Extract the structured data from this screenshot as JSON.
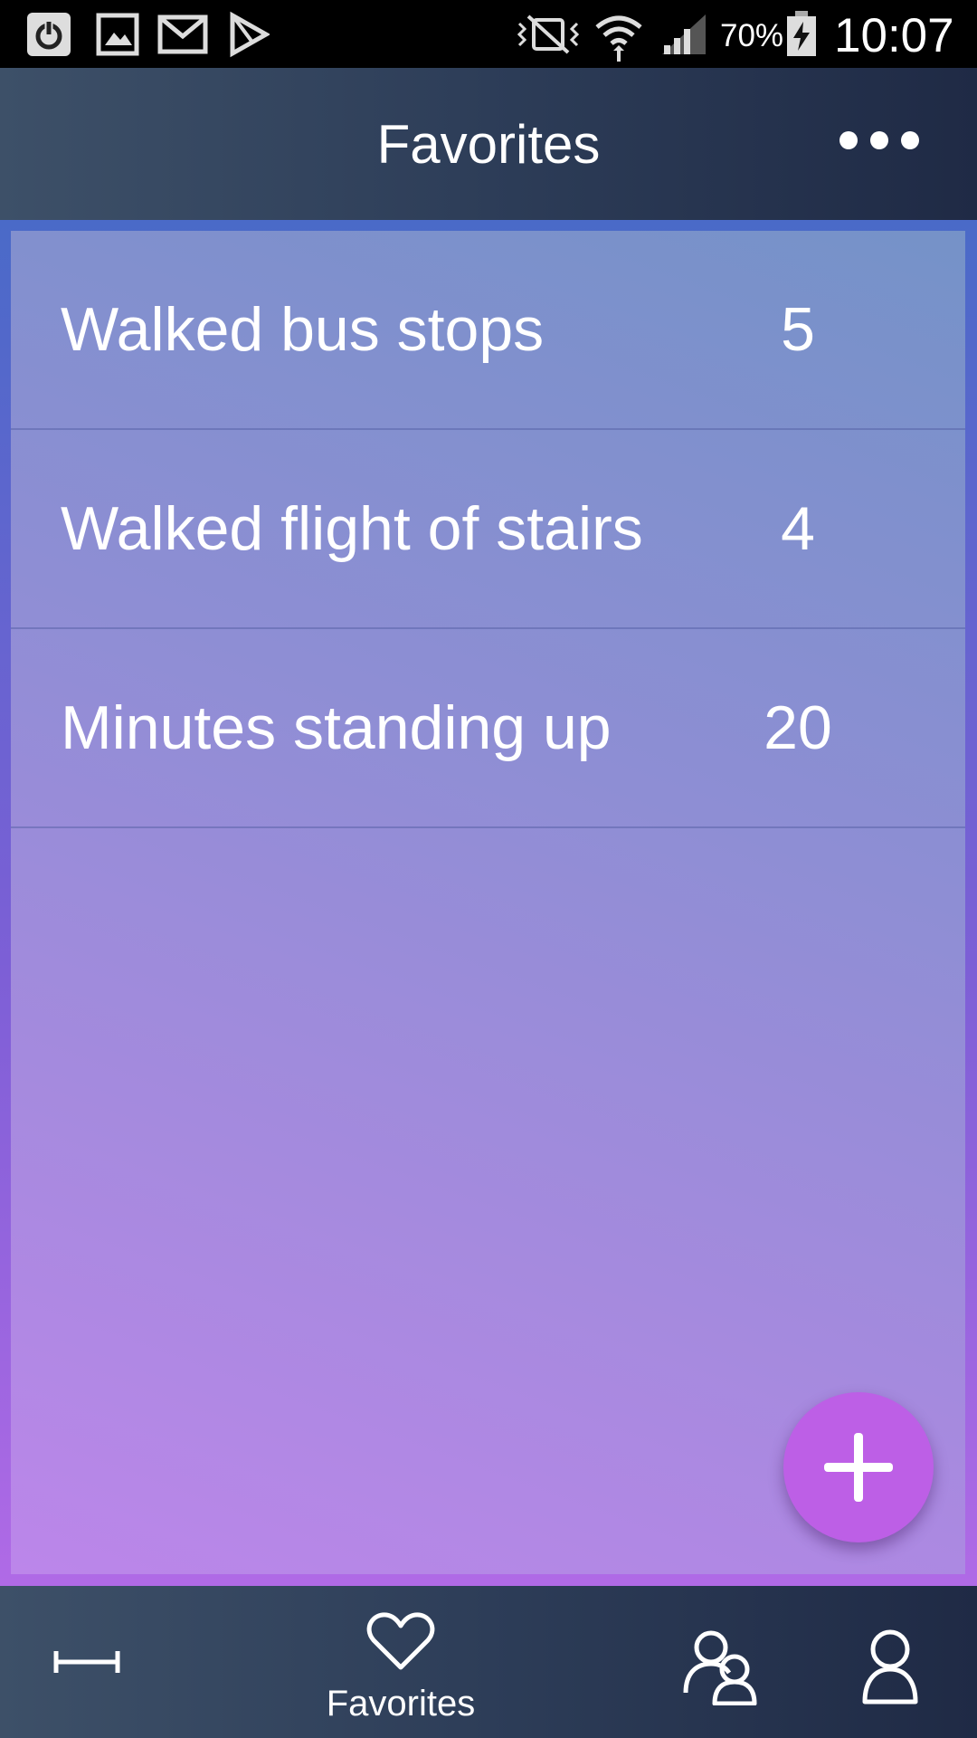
{
  "status_bar": {
    "left_icons": [
      "power-icon",
      "gallery-icon",
      "gmail-icon",
      "play-store-icon"
    ],
    "right_icons": [
      "vibrate-icon",
      "wifi-icon",
      "signal-icon",
      "battery-charging-icon"
    ],
    "battery_percent": "70%",
    "time": "10:07"
  },
  "header": {
    "title": "Favorites",
    "more_icon": "more-horizontal-icon"
  },
  "favorites": [
    {
      "label": "Walked bus stops",
      "value": "5"
    },
    {
      "label": "Walked flight of stairs",
      "value": "4"
    },
    {
      "label": "Minutes standing up",
      "value": "20"
    }
  ],
  "fab": {
    "icon": "plus-icon"
  },
  "bottom_nav": {
    "items": [
      {
        "icon": "measure-icon",
        "label": ""
      },
      {
        "icon": "heart-icon",
        "label": "Favorites",
        "active": true
      },
      {
        "icon": "group-icon",
        "label": ""
      },
      {
        "icon": "person-icon",
        "label": ""
      }
    ]
  },
  "colors": {
    "header_start": "#3d5068",
    "header_end": "#1f2a45",
    "fab": "#bd5fe6",
    "content_top": "#7592c8",
    "content_bottom": "#bc86ea"
  }
}
